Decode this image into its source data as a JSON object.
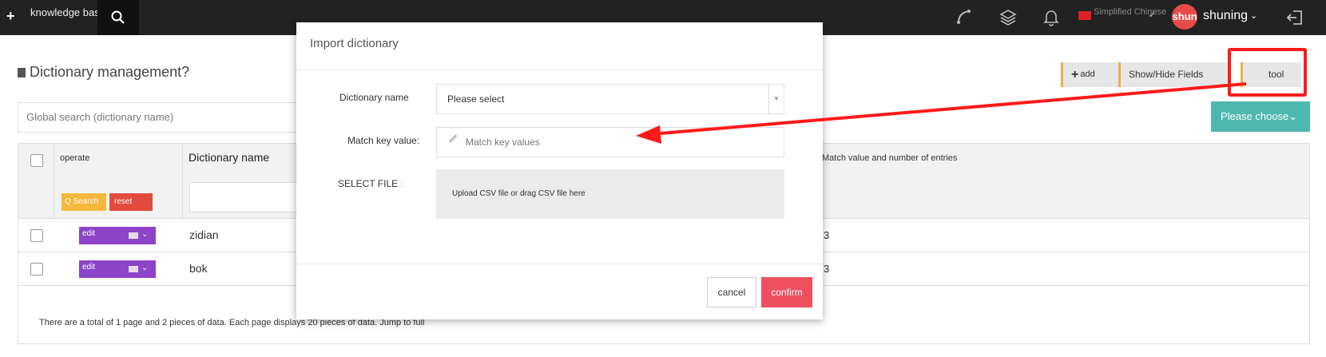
{
  "topbar": {
    "plus_icon": "+",
    "knowledge_base": "knowledge base",
    "language": "Simplified Chinese",
    "avatar": "shun",
    "username": "shuning",
    "caret": "⌄",
    "check": "✔"
  },
  "page": {
    "title": "Dictionary management?",
    "add_plus": "+",
    "add_label": "add",
    "showhide_label": "Show/Hide Fields",
    "tool_label": "tool",
    "global_search": "Global search (dictionary name)",
    "please_choose": "Please choose⌄"
  },
  "table": {
    "col_operate": "operate",
    "col_dict_name": "Dictionary name",
    "col_match": "Match value and number of entries",
    "search_btn": "Q Search",
    "reset_btn": "reset",
    "rows": [
      {
        "edit": "edit",
        "name": "zidian",
        "count": "3"
      },
      {
        "edit": "edit",
        "name": "bok",
        "count": "3"
      }
    ],
    "pager": "There are a total of 1 page and 2 pieces of data. Each page displays 20 pieces of data. Jump to full"
  },
  "modal": {
    "title": "Import dictionary",
    "dict_name_label": "Dictionary name",
    "dict_name_value": "Please select",
    "dd_arrow": "▼",
    "match_label": "Match key value:",
    "match_placeholder": "Match key values",
    "file_label": "SELECT FILE",
    "file_marker": ":",
    "upload_text": "Upload CSV file or drag CSV file here",
    "cancel": "cancel",
    "confirm": "confirm"
  },
  "colors": {
    "topbar": "#222222",
    "accent_orange": "#f0ad4e",
    "teal": "#4db8b0",
    "purple": "#8e44c8",
    "confirm": "#ee5060",
    "annotation_red": "#ff1a1a"
  }
}
